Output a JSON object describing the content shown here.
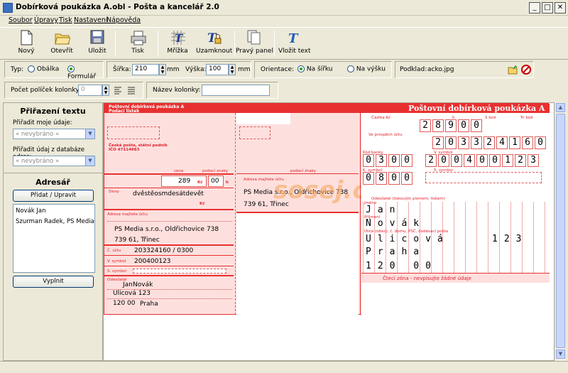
{
  "window": {
    "title": "Dobírková poukázka A.obl - Pošta a kancelář 2.0"
  },
  "menu": [
    "Soubor",
    "Úpravy",
    "Tisk",
    "Nastavení",
    "Nápověda"
  ],
  "toolbar": {
    "new": "Nový",
    "open": "Otevřít",
    "save": "Uložit",
    "print": "Tisk",
    "grid": "Mřížka",
    "lock": "Uzamknout",
    "right_panel": "Pravý panel",
    "insert_text": "Vložit text"
  },
  "options": {
    "type_label": "Typ:",
    "type_envelope": "Obálka",
    "type_form": "Formulář",
    "width_label": "Šířka:",
    "width_value": "210",
    "width_unit": "mm",
    "height_label": "Výška:",
    "height_value": "100",
    "height_unit": "mm",
    "orientation_label": "Orientace:",
    "orient_landscape": "Na šířku",
    "orient_portrait": "Na výšku",
    "background_label": "Podklad:",
    "background_value": "acko.jpg",
    "columns_label": "Počet políček kolonky:",
    "columns_value": "0",
    "column_name_label": "Název kolonky:",
    "column_name_value": ""
  },
  "left_panel": {
    "assign_title": "Přiřazení textu",
    "my_data_label": "Přiřadit moje údaje:",
    "my_data_value": "« nevybráno »",
    "db_label": "Přiřadit údaj z databáze adres:",
    "db_value": "« nevybráno »",
    "address_title": "Adresář",
    "add_edit_button": "Přidat / Upravit",
    "contacts": [
      "Novák Jan",
      "Szurman Radek, PS Media s.r."
    ],
    "fill_button": "Vyplnit"
  },
  "form": {
    "title": "Poštovní dobírková poukázka A",
    "corner_title": "Poštovní dobírková poukázka A",
    "corner_sub": "Podací lístek",
    "cp_name": "Česká pošta, státní podnik",
    "cp_ico": "IČO 47114983",
    "amount_caption": "cena",
    "amount_main": "289",
    "amount_currency": "Kč",
    "amount_cents": "00",
    "amount_h": "h",
    "halere_caption": "podací znaky",
    "words_label": "Slovy",
    "words_value": "dvěstěosmdesátdevět",
    "account_owner_label": "Adresa majitele účtu",
    "owner_line1": "PS Media s.r.o., Oldřichovice 738",
    "owner_line2": "739 61, Třinec",
    "account_label": "Č. účtu",
    "account_value": "203324160 / 0300",
    "vs_label": "V. symbol",
    "vs_value": "200400123",
    "ss_label": "S. symbol",
    "sender_label": "Odesílatel",
    "sender_first": "Jan",
    "sender_last": "Novák",
    "sender_street": "Ulicová 123",
    "sender_zip": "120 00",
    "sender_city": "Praha",
    "mid_owner_label": "Adresa majitele účtu",
    "mid_marks": "podací znaky",
    "mid_line1": "PS Media s.r.o., Oldřichovice 738",
    "mid_line2": "739 61, Třinec",
    "r_amount_label": "Částka Kč",
    "r_h": "h",
    "r_sk": "S kód",
    "r_tr": "Tr. kód",
    "r_amount": [
      "2",
      "8",
      "9",
      "0",
      "0"
    ],
    "r_account_label": "Ve prospěch účtu",
    "r_account": [
      "2",
      "0",
      "3",
      "3",
      "2",
      "4",
      "1",
      "6",
      "0"
    ],
    "r_bank_label": "Kód banky",
    "r_bank": [
      "0",
      "3",
      "0",
      "0"
    ],
    "r_vs_label": "V. symbol",
    "r_vs": [
      "2",
      "0",
      "0",
      "4",
      "0",
      "0",
      "1",
      "2",
      "3"
    ],
    "r_ks_label": "K. symbol",
    "r_ks": [
      "0",
      "8",
      "0",
      "0"
    ],
    "r_ss_label": "S. symbol",
    "r_sender_label": "Odesílatel (tiskovým písmem, tiskem)",
    "r_first_label": "Jméno",
    "r_first": "Jan",
    "r_last_label": "Příjmení",
    "r_last": "Novák",
    "r_street_label": "Ulice (obec), č. domu, PSČ, dodávací pošta",
    "r_street": "Ulicová",
    "r_number": "123",
    "r_city": "Praha",
    "r_zip": "120 00",
    "r_read_zone": "Čtecí zóna - nevpisujte žádné údaje",
    "watermark": "sosej.cz"
  },
  "colors": {
    "form_red": "#e83030",
    "form_bg": "#fde0de",
    "radio_on": "#21a121"
  }
}
